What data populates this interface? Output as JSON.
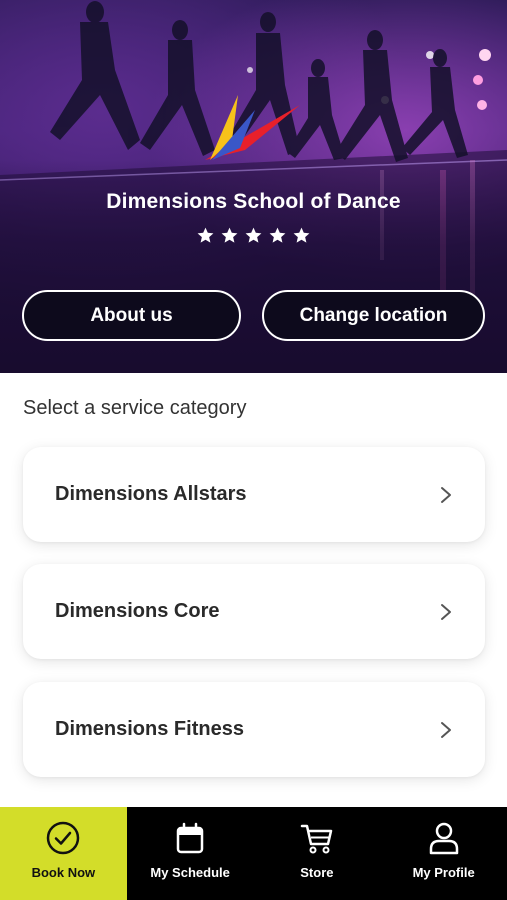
{
  "hero": {
    "school_name": "Dimensions School of Dance",
    "rating_stars": 5,
    "about_label": "About us",
    "change_location_label": "Change location"
  },
  "services": {
    "title": "Select a service category",
    "items": [
      {
        "label": "Dimensions Allstars"
      },
      {
        "label": "Dimensions Core"
      },
      {
        "label": "Dimensions Fitness"
      }
    ]
  },
  "tabbar": {
    "items": [
      {
        "label": "Book Now",
        "icon": "check-circle-icon",
        "active": true
      },
      {
        "label": "My Schedule",
        "icon": "calendar-icon",
        "active": false
      },
      {
        "label": "Store",
        "icon": "cart-icon",
        "active": false
      },
      {
        "label": "My Profile",
        "icon": "person-icon",
        "active": false
      }
    ]
  },
  "colors": {
    "accent": "#d3dd29",
    "tabbar_bg": "#000000",
    "hero_bg": "#2b1450"
  }
}
